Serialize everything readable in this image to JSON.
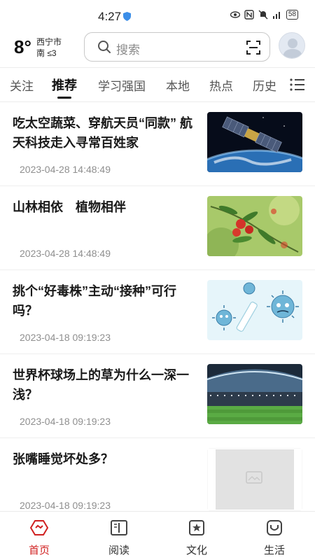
{
  "status_bar": {
    "time": "4:27",
    "battery": "58",
    "icons": [
      "shield-icon",
      "eye-icon",
      "nfc-icon",
      "mute-icon",
      "signal-icon",
      "battery-icon"
    ]
  },
  "weather": {
    "temperature": "8°",
    "city": "西宁市",
    "wind": "南 ≤3"
  },
  "search": {
    "placeholder": "搜索"
  },
  "tabs": [
    {
      "label": "关注"
    },
    {
      "label": "推荐"
    },
    {
      "label": "学习强国"
    },
    {
      "label": "本地"
    },
    {
      "label": "热点"
    },
    {
      "label": "历史"
    }
  ],
  "active_tab": "推荐",
  "news": [
    {
      "title": "吃太空蔬菜、穿航天员“同款” 航天科技走入寻常百姓家",
      "date": "2023-04-28 14:48:49",
      "thumbnail": "satellite-earth-image"
    },
    {
      "title": "山林相依　植物相伴",
      "date": "2023-04-28 14:48:49",
      "thumbnail": "red-berries-plant-image"
    },
    {
      "title": "挑个“好毒株”主动“接种”可行吗？",
      "date": "2023-04-18 09:19:23",
      "thumbnail": "virus-cartoon-image"
    },
    {
      "title": "世界杯球场上的草为什么一深一浅？",
      "date": "2023-04-18 09:19:23",
      "thumbnail": "stadium-image"
    },
    {
      "title": "张嘴睡觉坏处多？",
      "date": "2023-04-18 09:19:23",
      "thumbnail": "placeholder-image"
    }
  ],
  "bottom_nav": [
    {
      "label": "首页",
      "icon": "home-icon",
      "active": true
    },
    {
      "label": "阅读",
      "icon": "book-icon",
      "active": false
    },
    {
      "label": "文化",
      "icon": "culture-icon",
      "active": false
    },
    {
      "label": "生活",
      "icon": "life-icon",
      "active": false
    }
  ],
  "colors": {
    "accent": "#d02020",
    "text_primary": "#1a1a1a",
    "text_secondary": "#8f8f8f"
  }
}
